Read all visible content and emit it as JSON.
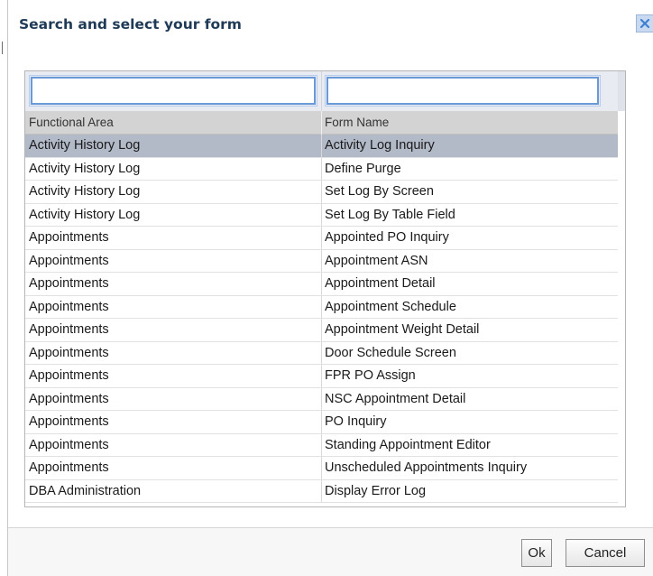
{
  "dialog": {
    "title": "Search and select your form",
    "close_icon": "close-icon"
  },
  "filters": {
    "functional_area_value": "",
    "form_name_value": ""
  },
  "table": {
    "headers": [
      "Functional Area",
      "Form Name"
    ],
    "rows": [
      {
        "area": "Activity History Log",
        "form": "Activity Log Inquiry",
        "selected": true
      },
      {
        "area": "Activity History Log",
        "form": "Define Purge"
      },
      {
        "area": "Activity History Log",
        "form": "Set Log By Screen"
      },
      {
        "area": "Activity History Log",
        "form": "Set Log By Table Field"
      },
      {
        "area": "Appointments",
        "form": "Appointed PO Inquiry"
      },
      {
        "area": "Appointments",
        "form": "Appointment ASN"
      },
      {
        "area": "Appointments",
        "form": "Appointment Detail"
      },
      {
        "area": "Appointments",
        "form": "Appointment Schedule"
      },
      {
        "area": "Appointments",
        "form": "Appointment Weight Detail"
      },
      {
        "area": "Appointments",
        "form": "Door Schedule Screen"
      },
      {
        "area": "Appointments",
        "form": "FPR PO Assign"
      },
      {
        "area": "Appointments",
        "form": "NSC Appointment Detail"
      },
      {
        "area": "Appointments",
        "form": "PO Inquiry"
      },
      {
        "area": "Appointments",
        "form": "Standing Appointment Editor"
      },
      {
        "area": "Appointments",
        "form": "Unscheduled Appointments Inquiry"
      },
      {
        "area": "DBA Administration",
        "form": "Display Error Log"
      }
    ]
  },
  "buttons": {
    "ok": "Ok",
    "cancel": "Cancel"
  }
}
